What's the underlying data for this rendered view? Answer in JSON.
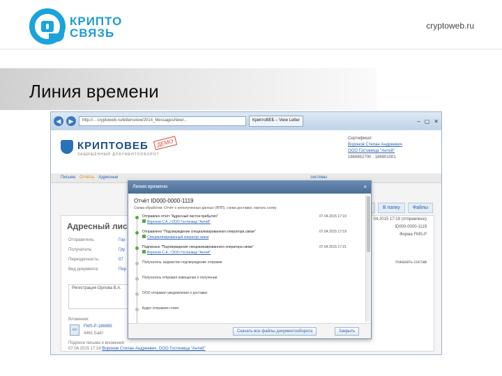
{
  "slide": {
    "logo_line1": "КРИПТО",
    "logo_line2": "СВЯЗЬ",
    "url": "cryptoweb.ru",
    "title": "Линия времени"
  },
  "browser": {
    "address": "http://... cryptoweb.ru/lettersview/2014_MessagesNew/...",
    "tab_label": "КриптоВЕБ – View Letter",
    "controls": [
      "–",
      "▢",
      "✕"
    ]
  },
  "app": {
    "logo": "КРИПТОВЕБ",
    "logo_sub": "ЗАЩИЩЁННЫЙ ДОКУМЕНТООБОРОТ",
    "demo": "ДЕМО",
    "cert": {
      "label": "Сертификат:",
      "owner": "Воронов Степан Андреевич",
      "org": "ООО Гостиница \"Антей\"",
      "ids": "1869852700 · 186901001"
    },
    "menu": [
      "Письма",
      "Отчёты",
      "Адресные",
      "системы"
    ],
    "right_tabs": [
      "В"
    ]
  },
  "panel": {
    "title": "Адресный лист",
    "fields": [
      {
        "label": "Отправитель:",
        "value": "Гор"
      },
      {
        "label": "Получатель:",
        "value": "Гру"
      },
      {
        "label": "Периодичность:",
        "value": "07"
      },
      {
        "label": "Вид документа:",
        "value": "Пер"
      }
    ],
    "right_lines": [
      "04.2015 17:19 (отправлено)",
      "ID000-0000-1119",
      "Форма FMS-P"
    ],
    "right_tabs": [
      "ан",
      "В папку",
      "Файлы"
    ],
    "show_compose": "показать состав",
    "registration": "Регистрация Орлова В.А.",
    "attachments_label": "Вложения:",
    "attachment_icon": "</>",
    "attachment_name": "FMS-P-186985",
    "attachment_size": "4461 Байт",
    "signed_label": "Подписи письма и вложений:",
    "signed_date": "07.04.2015 17:19",
    "signed_by": "Воронов Степан Андреевич, ООО Гостиница \"Антей\""
  },
  "modal": {
    "title": "Линия времени",
    "close": "×",
    "report": "Отчёт ID000-0000-1119",
    "desc": "Схема обработки: Отчёт о неполученных данных (ЯПП), схема доставки, хватать схему",
    "events": [
      {
        "text": "Отправлен отчёт \"Адресный листок прибытия\"",
        "sub": "Воронов С.А. / ООО Гостиница \"Антей\"",
        "time": "07.04.2015 17:19",
        "done": true
      },
      {
        "text": "Отправлено \"Подтверждение специализированного оператора связи\"",
        "sub": "Специализированный оператор связи",
        "time": "07.04.2015 17:19",
        "done": true
      },
      {
        "text": "Подписано \"Подтверждение специализированного оператора связи\"",
        "sub": "Воронов С.А. / ООО Гостиница \"Антей\"",
        "time": "07.04.2015 17:21",
        "done": true
      },
      {
        "text": "Получатель: ведомство подтверждение отправки",
        "sub": "",
        "time": "",
        "done": false
      },
      {
        "text": "Получатель отправил извещение о получении",
        "sub": "",
        "time": "",
        "done": false
      },
      {
        "text": "ООО отправил уведомление о доставке",
        "sub": "",
        "time": "",
        "done": false
      },
      {
        "text": "Будет отправлен ответ",
        "sub": "",
        "time": "",
        "done": false
      }
    ],
    "btn_download": "Скачать все файлы документооборота",
    "btn_close": "Закрыть"
  }
}
